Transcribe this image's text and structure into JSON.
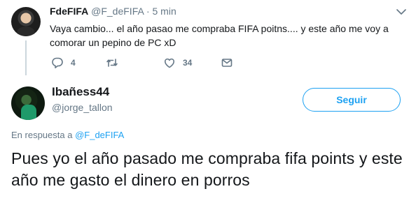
{
  "parent_tweet": {
    "name": "FdeFIFA",
    "handle": "@F_deFIFA",
    "separator": "·",
    "time": "5 min",
    "text": "Vaya cambio... el año pasao me compraba FIFA poitns.... y este año me voy a comorar un pepino de PC xD",
    "actions": {
      "reply_count": "4",
      "retweet_count": "",
      "like_count": "34"
    }
  },
  "reply_tweet": {
    "name": "Ibañess44",
    "handle": "@jorge_tallon",
    "follow_label": "Seguir",
    "in_reply_prefix": "En respuesta a",
    "in_reply_mention": "@F_deFIFA",
    "text": "Pues yo el año pasado me compraba fifa points y este año me gasto el dinero en porros"
  },
  "colors": {
    "accent": "#1da1f2",
    "text": "#14171a",
    "secondary": "#657786",
    "thread_line": "#ccd6dd"
  },
  "icons": [
    "reply-icon",
    "retweet-icon",
    "like-icon",
    "message-icon",
    "chevron-down-icon"
  ]
}
